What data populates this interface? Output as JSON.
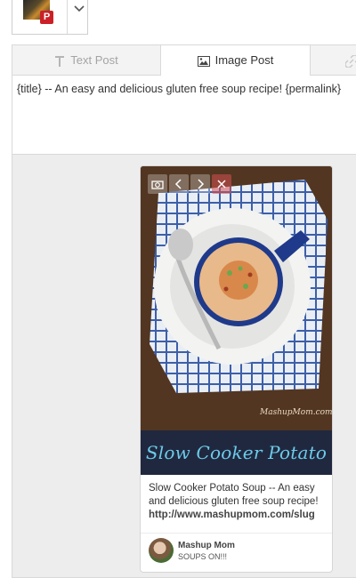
{
  "account": {
    "network_badge": "P",
    "network": "Pinterest"
  },
  "tabs": [
    {
      "label": "Text Post",
      "icon": "text-T-icon",
      "active": false
    },
    {
      "label": "Image Post",
      "icon": "image-icon",
      "active": true
    },
    {
      "label": "",
      "icon": "link-icon",
      "active": false
    }
  ],
  "composer": {
    "message": "{title} -- An easy and delicious gluten free soup recipe! {permalink}"
  },
  "pin": {
    "banner_text": "Slow Cooker Potato Soup",
    "watermark": "MashupMom.com",
    "description_line1": "Slow Cooker Potato Soup -- An easy",
    "description_line2": "and delicious gluten free soup recipe!",
    "description_link": "http://www.mashupmom.com/slug",
    "user_name": "Mashup Mom",
    "board_name": "SOUPS ON!!!"
  },
  "colors": {
    "pinterest_red": "#cb2027",
    "banner_bg": "#20283f",
    "banner_text": "#6ccbe9",
    "panel_bg": "#ededed"
  }
}
